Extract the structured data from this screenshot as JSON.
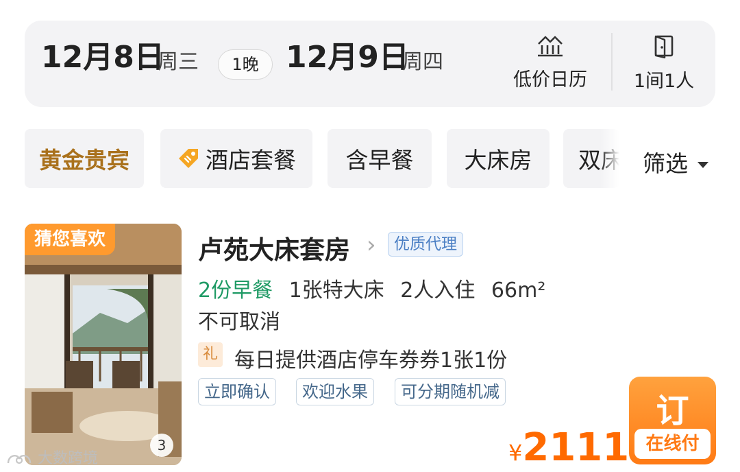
{
  "dates": {
    "checkin": "12月8日",
    "checkin_weekday": "周三",
    "nights": "1晚",
    "checkout": "12月9日",
    "checkout_weekday": "周四"
  },
  "tools": {
    "calendar_label": "低价日历",
    "calendar_icon": "price-trend-icon",
    "rooms_label": "1间1人",
    "rooms_icon": "door-icon"
  },
  "filters": {
    "chips": [
      "黄金贵宾",
      "酒店套餐",
      "含早餐",
      "大床房",
      "双床"
    ],
    "filter_label": "筛选",
    "accent_gold": "#a9711c"
  },
  "room": {
    "badge": "猜您喜欢",
    "image_count": "3",
    "title": "卢苑大床套房",
    "agent_badge": "优质代理",
    "breakfast": "2份早餐",
    "bed": "1张特大床",
    "guests": "2人入住",
    "area": "66m²",
    "cancel_policy": "不可取消",
    "gift_label": "礼",
    "gift_text": "每日提供酒店停车券券1张1份",
    "tags": [
      "立即确认",
      "欢迎水果",
      "可分期随机减"
    ],
    "currency": "¥",
    "price": "2111",
    "book_label": "订",
    "pay_label": "在线付",
    "accent_orange": "#ff7a14",
    "breakfast_color": "#1f9a65"
  },
  "watermark": "大数跨境"
}
